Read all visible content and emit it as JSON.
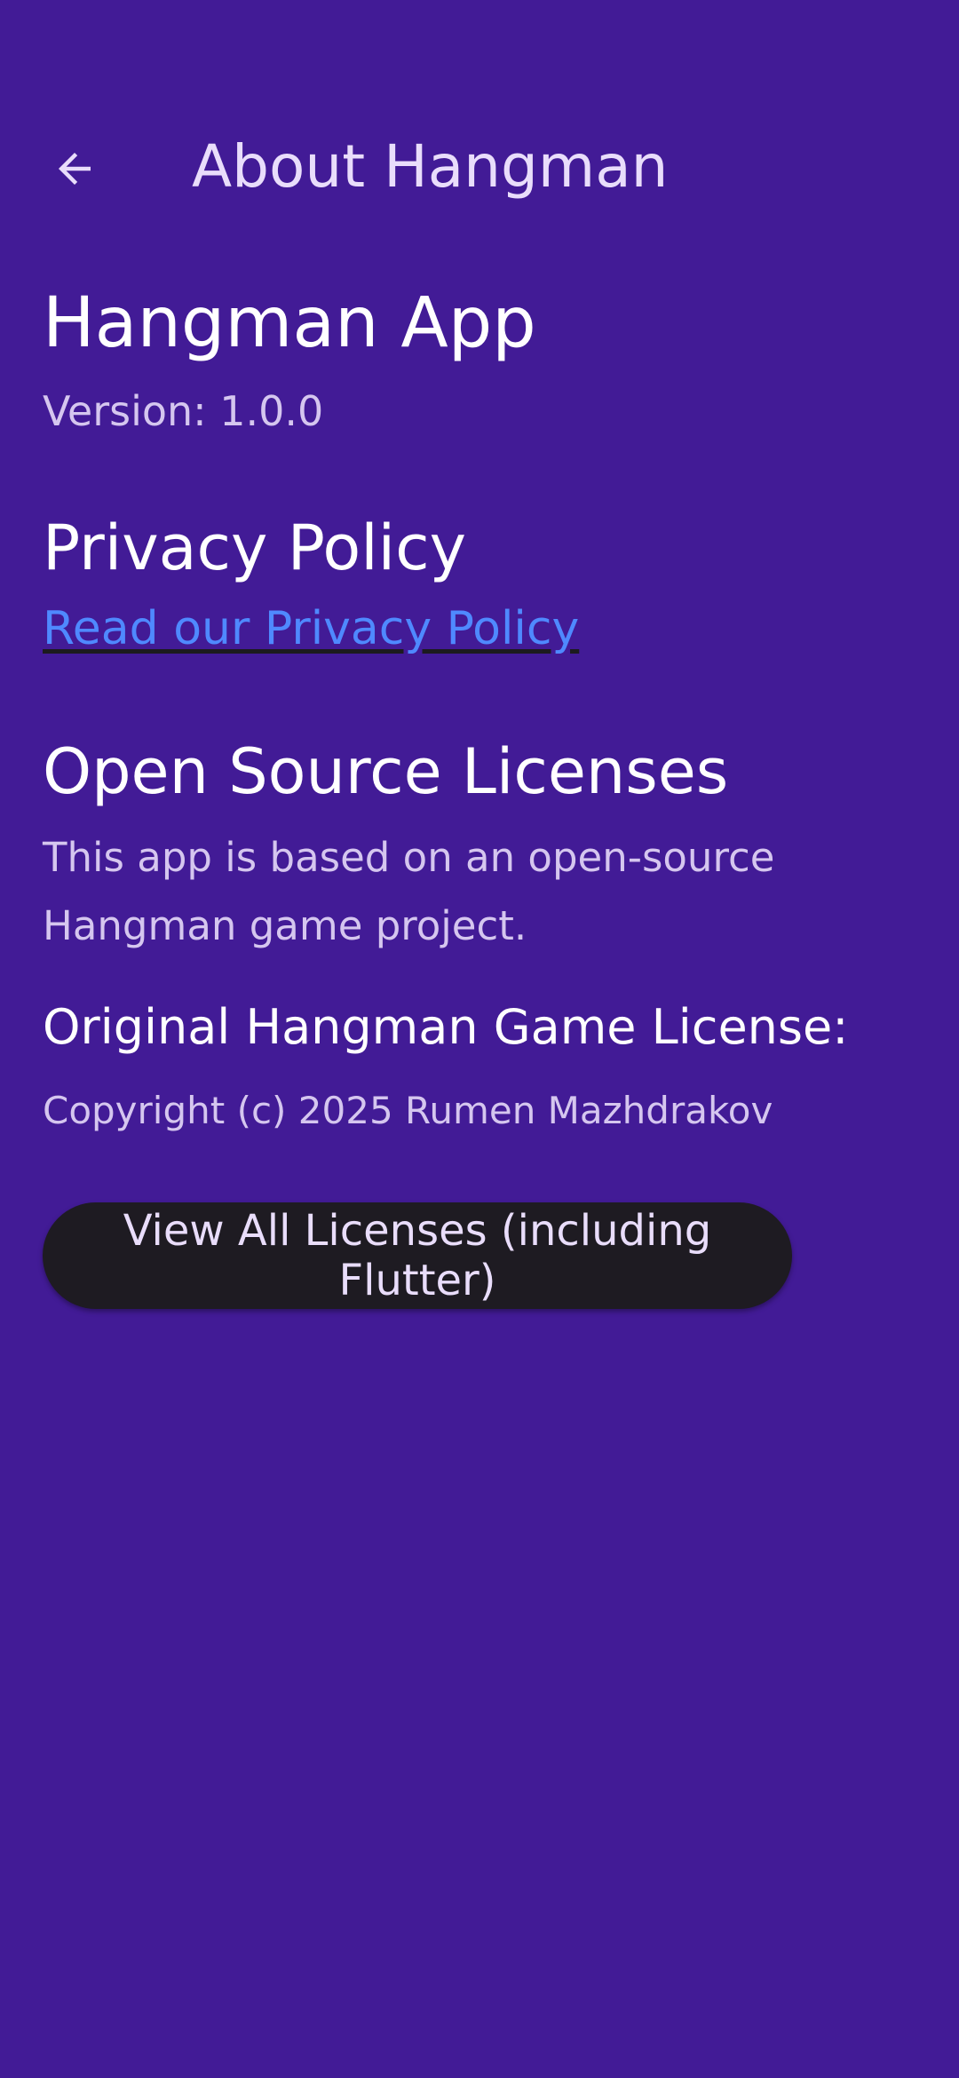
{
  "app_bar": {
    "back_icon": "arrow-back-icon",
    "title": "About Hangman"
  },
  "app_info": {
    "name": "Hangman App",
    "version": "Version: 1.0.0"
  },
  "privacy": {
    "heading": "Privacy Policy",
    "link_text": "Read our Privacy Policy"
  },
  "licenses": {
    "heading": "Open Source Licenses",
    "description": "This app is based on an open-source Hangman game project.",
    "original_heading": "Original Hangman Game License:",
    "copyright": "Copyright (c) 2025 Rumen Mazhdrakov",
    "button_label": "View All Licenses (including Flutter)"
  },
  "colors": {
    "background": "#421b96",
    "link": "#4f89ff",
    "button_bg": "#1e1b22",
    "button_text": "#e9ddfb",
    "secondary_text": "#d5c6ef"
  }
}
